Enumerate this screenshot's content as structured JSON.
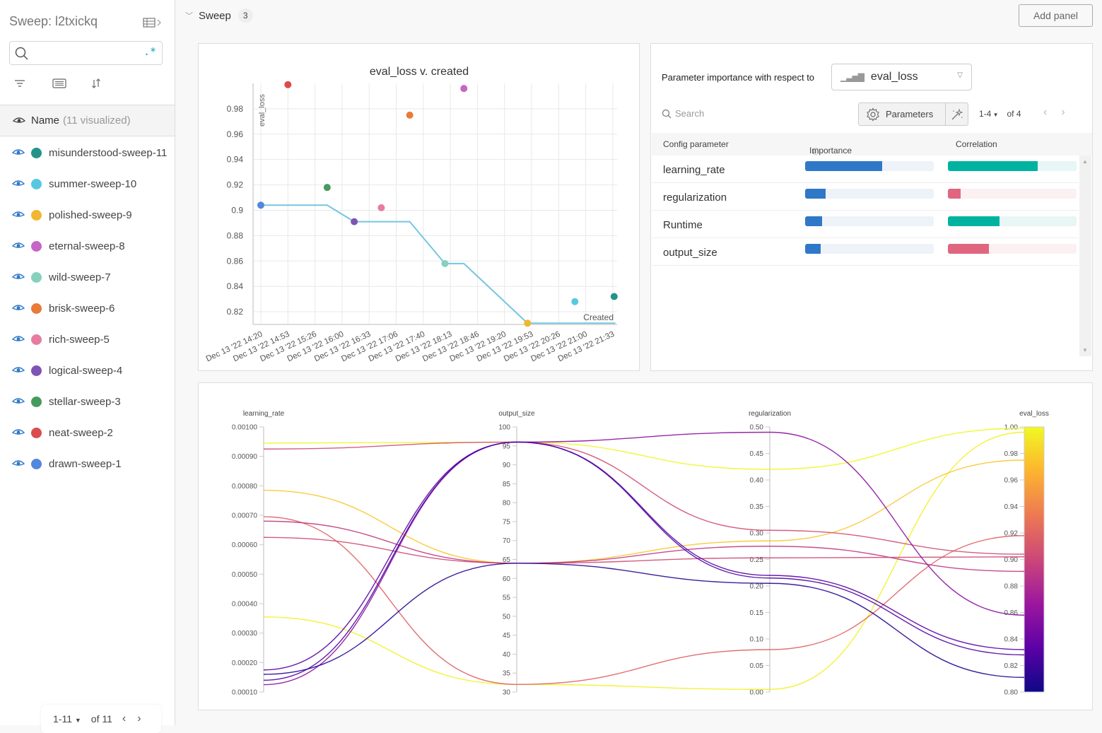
{
  "sidebar": {
    "title": "Sweep: l2txickq",
    "search_placeholder": "",
    "regex_label": ".*",
    "header_name": "Name",
    "header_count": "(11 visualized)",
    "runs": [
      {
        "name": "misunderstood-sweep-11",
        "color": "#229487"
      },
      {
        "name": "summer-sweep-10",
        "color": "#58c8e0"
      },
      {
        "name": "polished-sweep-9",
        "color": "#f0b72f"
      },
      {
        "name": "eternal-sweep-8",
        "color": "#c565c7"
      },
      {
        "name": "wild-sweep-7",
        "color": "#87d0be"
      },
      {
        "name": "brisk-sweep-6",
        "color": "#e87b38"
      },
      {
        "name": "rich-sweep-5",
        "color": "#e87ca0"
      },
      {
        "name": "logical-sweep-4",
        "color": "#7e54b5"
      },
      {
        "name": "stellar-sweep-3",
        "color": "#479a5f"
      },
      {
        "name": "neat-sweep-2",
        "color": "#db4c4c"
      },
      {
        "name": "drawn-sweep-1",
        "color": "#5387dd"
      }
    ],
    "pager": {
      "range": "1-11",
      "of": "of 11"
    }
  },
  "main": {
    "section_title": "Sweep",
    "section_count": "3",
    "add_panel_label": "Add panel"
  },
  "importance": {
    "label": "Parameter importance with respect to",
    "metric": "eval_loss",
    "search_placeholder": "Search",
    "parameters_label": "Parameters",
    "pager_range": "1-4",
    "pager_of": "of 4",
    "col_param": "Config parameter",
    "col_importance": "Importance",
    "col_correlation": "Correlation",
    "colors": {
      "importance": "#2f78c8",
      "importance_bg": "#eef2f9",
      "pos": "#00b3a0",
      "pos_bg": "#e8f6f5",
      "neg": "#e0667f",
      "neg_bg": "#fbf0f2"
    },
    "rows": [
      {
        "param": "learning_rate",
        "importance": 0.6,
        "correlation": 0.7
      },
      {
        "param": "regularization",
        "importance": 0.16,
        "correlation": -0.1
      },
      {
        "param": "Runtime",
        "importance": 0.13,
        "correlation": 0.4
      },
      {
        "param": "output_size",
        "importance": 0.12,
        "correlation": -0.32
      }
    ]
  },
  "chart_data": [
    {
      "type": "scatter",
      "title": "eval_loss v. created",
      "xlabel": "Created",
      "ylabel": "eval_loss",
      "x_ticks": [
        "Dec 13 '22 14:20",
        "Dec 13 '22 14:53",
        "Dec 13 '22 15:26",
        "Dec 13 '22 16:00",
        "Dec 13 '22 16:33",
        "Dec 13 '22 17:06",
        "Dec 13 '22 17:40",
        "Dec 13 '22 18:13",
        "Dec 13 '22 18:46",
        "Dec 13 '22 19:20",
        "Dec 13 '22 19:53",
        "Dec 13 '22 20:26",
        "Dec 13 '22 21:00",
        "Dec 13 '22 21:33"
      ],
      "y_ticks": [
        0.82,
        0.84,
        0.86,
        0.88,
        0.9,
        0.92,
        0.94,
        0.96,
        0.98
      ],
      "ylim": [
        0.81,
        1.0
      ],
      "xlim_index": [
        0,
        13.1
      ],
      "grid": true,
      "points": [
        {
          "run": "drawn-sweep-1",
          "x": 0.0,
          "y": 0.904,
          "color": "#5387dd"
        },
        {
          "run": "neat-sweep-2",
          "x": 1.0,
          "y": 0.999,
          "color": "#db4c4c"
        },
        {
          "run": "stellar-sweep-3",
          "x": 2.45,
          "y": 0.918,
          "color": "#479a5f"
        },
        {
          "run": "logical-sweep-4",
          "x": 3.45,
          "y": 0.891,
          "color": "#7e54b5"
        },
        {
          "run": "rich-sweep-5",
          "x": 4.45,
          "y": 0.902,
          "color": "#e87ca0"
        },
        {
          "run": "brisk-sweep-6",
          "x": 5.5,
          "y": 0.975,
          "color": "#e87b38"
        },
        {
          "run": "wild-sweep-7",
          "x": 6.8,
          "y": 0.858,
          "color": "#87d0be"
        },
        {
          "run": "eternal-sweep-8",
          "x": 7.5,
          "y": 0.996,
          "color": "#c565c7"
        },
        {
          "run": "polished-sweep-9",
          "x": 9.85,
          "y": 0.811,
          "color": "#f0b72f"
        },
        {
          "run": "summer-sweep-10",
          "x": 11.6,
          "y": 0.828,
          "color": "#58c8e0"
        },
        {
          "run": "misunderstood-sweep-11",
          "x": 13.05,
          "y": 0.832,
          "color": "#229487"
        }
      ],
      "best_line": {
        "color": "#74c6e0",
        "points": [
          [
            0.0,
            0.904
          ],
          [
            2.45,
            0.904
          ],
          [
            3.45,
            0.891
          ],
          [
            5.5,
            0.891
          ],
          [
            6.8,
            0.858
          ],
          [
            7.5,
            0.858
          ],
          [
            9.85,
            0.811
          ],
          [
            13.1,
            0.811
          ]
        ]
      }
    },
    {
      "type": "parallel_coordinates",
      "axes": [
        {
          "name": "learning_rate",
          "range": [
            0.0001,
            0.001
          ],
          "ticks": [
            "0.00010",
            "0.00020",
            "0.00030",
            "0.00040",
            "0.00050",
            "0.00060",
            "0.00070",
            "0.00080",
            "0.00090",
            "0.00100"
          ]
        },
        {
          "name": "output_size",
          "range": [
            30,
            100
          ],
          "ticks": [
            "30",
            "35",
            "40",
            "45",
            "50",
            "55",
            "60",
            "65",
            "70",
            "75",
            "80",
            "85",
            "90",
            "95",
            "100"
          ]
        },
        {
          "name": "regularization",
          "range": [
            0,
            0.5
          ],
          "ticks": [
            "0.00",
            "0.05",
            "0.10",
            "0.15",
            "0.20",
            "0.25",
            "0.30",
            "0.35",
            "0.40",
            "0.45",
            "0.50"
          ]
        },
        {
          "name": "eval_loss",
          "range": [
            0.8,
            1.0
          ],
          "ticks": [
            "0.80",
            "0.82",
            "0.84",
            "0.86",
            "0.88",
            "0.90",
            "0.92",
            "0.94",
            "0.96",
            "0.98",
            "1.00"
          ]
        }
      ],
      "colorscale": [
        "#0d0887",
        "#5c01a6",
        "#9c179e",
        "#cc4778",
        "#ed7953",
        "#fdb42f",
        "#f0f921"
      ],
      "lines": [
        {
          "values": [
            0.000945,
            96,
            0.42,
            0.999
          ]
        },
        {
          "values": [
            0.000355,
            32,
            0.005,
            0.996
          ]
        },
        {
          "values": [
            0.000785,
            64,
            0.285,
            0.975
          ]
        },
        {
          "values": [
            0.000695,
            32,
            0.08,
            0.918
          ]
        },
        {
          "values": [
            0.000925,
            96,
            0.305,
            0.904
          ]
        },
        {
          "values": [
            0.000625,
            64,
            0.253,
            0.902
          ]
        },
        {
          "values": [
            0.00068,
            64,
            0.275,
            0.891
          ]
        },
        {
          "values": [
            0.000125,
            96,
            0.49,
            0.858
          ]
        },
        {
          "values": [
            0.000175,
            96,
            0.22,
            0.832
          ]
        },
        {
          "values": [
            0.00014,
            96,
            0.215,
            0.828
          ]
        },
        {
          "values": [
            0.00016,
            64,
            0.205,
            0.811
          ]
        }
      ]
    }
  ]
}
